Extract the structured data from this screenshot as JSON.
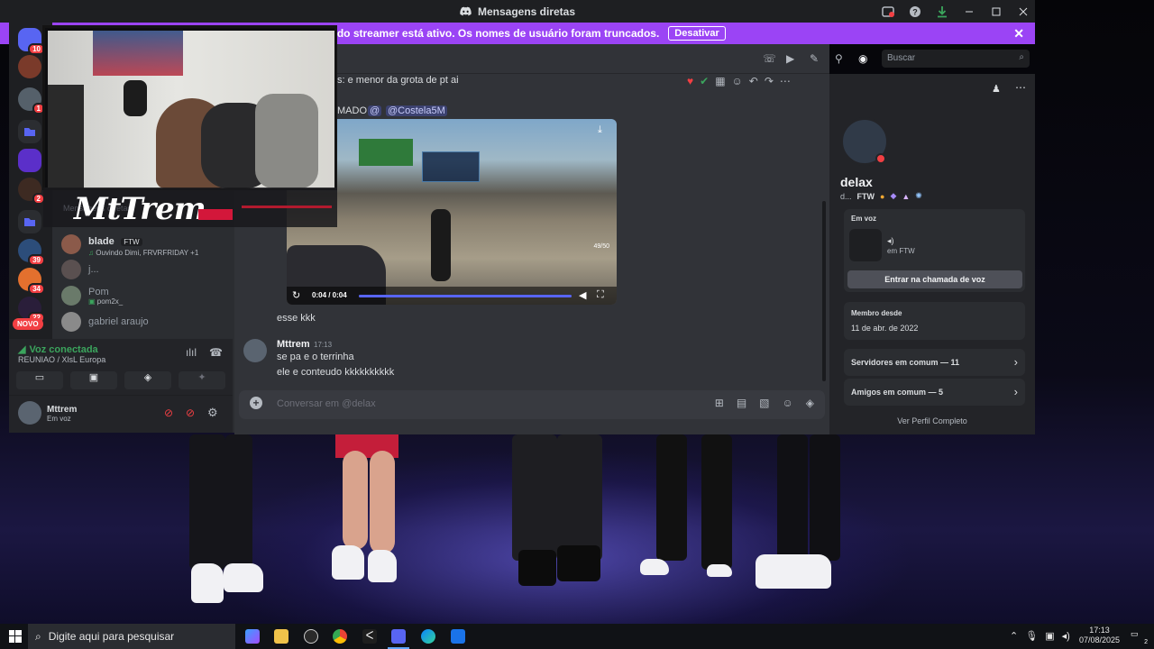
{
  "window": {
    "title": "Mensagens diretas"
  },
  "streamer_banner": {
    "text": "O modo streamer está ativo. Os nomes de usuário foram truncados.",
    "disable_label": "Desativar"
  },
  "rail": {
    "home_badge": "10",
    "badges": [
      "1",
      "1",
      "2",
      "39",
      "34",
      "22"
    ],
    "new_label": "NOVO"
  },
  "sidebar": {
    "dms": [
      {
        "name": "blade",
        "tag": "FTW",
        "status": "Ouvindo Dimi, FRVRFRIDAY +1"
      },
      {
        "name": "j...",
        "tag": "",
        "status": ""
      },
      {
        "name": "Pom",
        "tag": "",
        "status": "pom2x_"
      },
      {
        "name": "gabriel araujo",
        "tag": "",
        "status": ""
      }
    ]
  },
  "voice": {
    "status": "Voz conectada",
    "channel": "REUNIAO / XlsL Europa"
  },
  "user": {
    "name": "Mttrem",
    "status": "Em voz"
  },
  "chat": {
    "search_placeholder": "Buscar",
    "messages": [
      {
        "text": "s: e menor da grota de pt ai"
      },
      {
        "text": "MADO"
      },
      {
        "mention1": "@",
        "mention2": "@Costela5M"
      },
      {
        "text": "esse kkk"
      }
    ],
    "video": {
      "time": "0:04 / 0:04",
      "progress": 1.0,
      "watermark": "49/50"
    },
    "reply": {
      "author": "Mttrem",
      "time": "17:13",
      "line1": "se pa e o terrinha",
      "line2": "ele e conteudo kkkkkkkkkk"
    },
    "composer_placeholder": "Conversar em @delax"
  },
  "profile": {
    "name": "delax",
    "sub": "d...",
    "tag": "FTW",
    "in_voice_title": "Em voz",
    "in_voice_place": "em FTW",
    "join_button": "Entrar na chamada de voz",
    "member_since_title": "Membro desde",
    "member_since": "11 de abr. de 2022",
    "servers_common": "Servidores em comum — 11",
    "friends_common": "Amigos em comum — 5",
    "full_profile": "Ver Perfil Completo"
  },
  "overlay": {
    "streamer_name": "MtTrem",
    "hidden_text": "Mensagens diretas"
  },
  "taskbar": {
    "search_placeholder": "Digite aqui para pesquisar",
    "time": "17:13",
    "date": "07/08/2025",
    "notification_count": "2"
  }
}
